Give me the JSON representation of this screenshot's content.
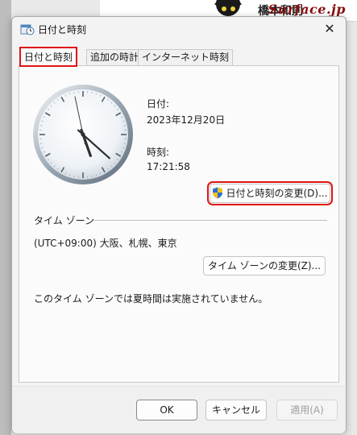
{
  "background": {
    "user_name": "橋本和則",
    "watermark": "Surface.jp"
  },
  "dialog": {
    "title": "日付と時刻",
    "close_glyph": "✕",
    "tabs": [
      {
        "label": "日付と時刻",
        "active": true
      },
      {
        "label": "追加の時計",
        "active": false
      },
      {
        "label": "インターネット時刻",
        "active": false
      }
    ],
    "date_label": "日付:",
    "date_value": "2023年12月20日",
    "time_label": "時刻:",
    "time_value": "17:21:58",
    "change_datetime_button": "日付と時刻の変更(D)...",
    "timezone_section_label": "タイム ゾーン",
    "timezone_value": "(UTC+09:00) 大阪、札幌、東京",
    "change_timezone_button": "タイム ゾーンの変更(Z)...",
    "dst_message": "このタイム ゾーンでは夏時間は実施されていません。",
    "buttons": {
      "ok": "OK",
      "cancel": "キャンセル",
      "apply": "適用(A)"
    }
  },
  "clock": {
    "hours": 17,
    "minutes": 21,
    "seconds": 58
  },
  "colors": {
    "highlight": "#e01414",
    "shield_blue": "#2a6fd6",
    "shield_yellow": "#f2c318"
  }
}
